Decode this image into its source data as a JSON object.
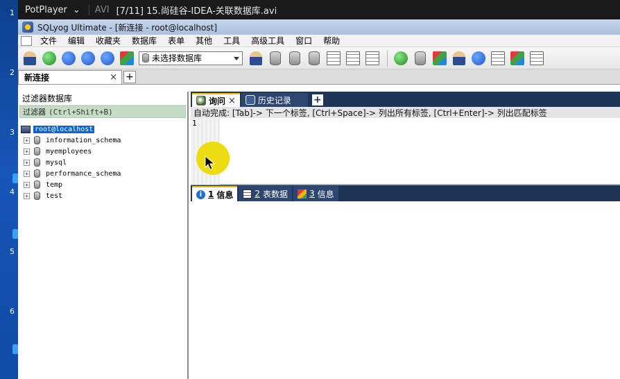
{
  "desktop": {
    "numbers": [
      "1",
      "2",
      "3",
      "4",
      "5",
      "6"
    ]
  },
  "player": {
    "name": "PotPlayer",
    "chevron": "⌄",
    "format": "AVI",
    "title": "[7/11] 15.尚硅谷-IDEA-关联数据库.avi"
  },
  "app": {
    "title": "SQLyog Ultimate - [新连接 - root@localhost]",
    "menu": [
      "文件",
      "编辑",
      "收藏夹",
      "数据库",
      "表单",
      "其他",
      "工具",
      "高级工具",
      "窗口",
      "帮助"
    ],
    "db_select": "未选择数据库",
    "connection_tab": "新连接",
    "close_symbol": "×",
    "plus_symbol": "+"
  },
  "left_panel": {
    "header": "过滤器数据库",
    "filter_label": "过滤器",
    "filter_hint": "(Ctrl+Shift+B)",
    "root": "root@localhost",
    "databases": [
      "information_schema",
      "myemployees",
      "mysql",
      "performance_schema",
      "temp",
      "test"
    ]
  },
  "query_tabs": [
    {
      "label": "询问",
      "icon": "query-icon",
      "closable": true
    },
    {
      "label": "历史记录",
      "icon": "history-icon",
      "closable": false
    }
  ],
  "autocomplete": "自动完成: [Tab]-> 下一个标签, [Ctrl+Space]-> 列出所有标签, [Ctrl+Enter]-> 列出匹配标签",
  "editor": {
    "line_number": "1"
  },
  "result_tabs": [
    {
      "num": "1",
      "label": "信息",
      "icon": "info-icon"
    },
    {
      "num": "2",
      "label": "表数据",
      "icon": "table-data-icon"
    },
    {
      "num": "3",
      "label": "信息",
      "icon": "message-icon"
    }
  ],
  "colors": {
    "tab_dark": "#1f3558",
    "selection": "#0a64d8",
    "filter_bg": "#c6dcc6",
    "cursor_highlight": "#ecdc10"
  }
}
